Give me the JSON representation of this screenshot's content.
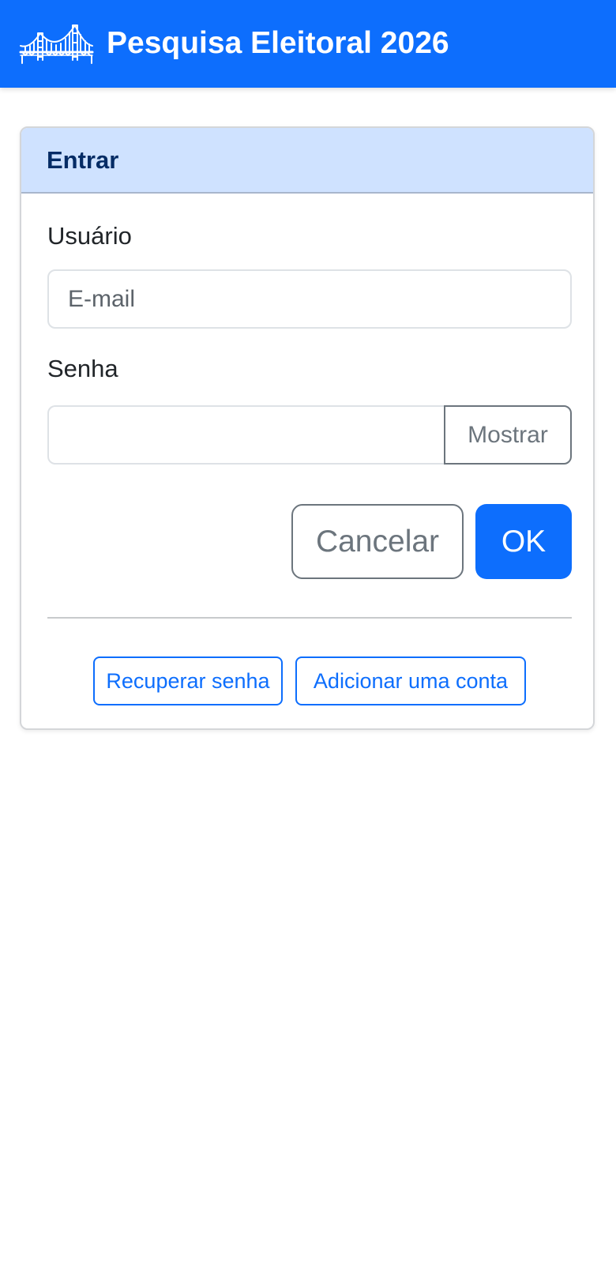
{
  "header": {
    "title": "Pesquisa Eleitoral 2026",
    "logo_icon": "bridge-icon",
    "background_color": "#0d6efd"
  },
  "login_card": {
    "title": "Entrar",
    "header_color": "#cfe2ff",
    "username": {
      "label": "Usuário",
      "placeholder": "E-mail",
      "value": ""
    },
    "password": {
      "label": "Senha",
      "value": "",
      "show_button_label": "Mostrar"
    },
    "actions": {
      "cancel_label": "Cancelar",
      "ok_label": "OK"
    },
    "links": {
      "recover_password_label": "Recuperar senha",
      "add_account_label": "Adicionar uma conta"
    }
  }
}
